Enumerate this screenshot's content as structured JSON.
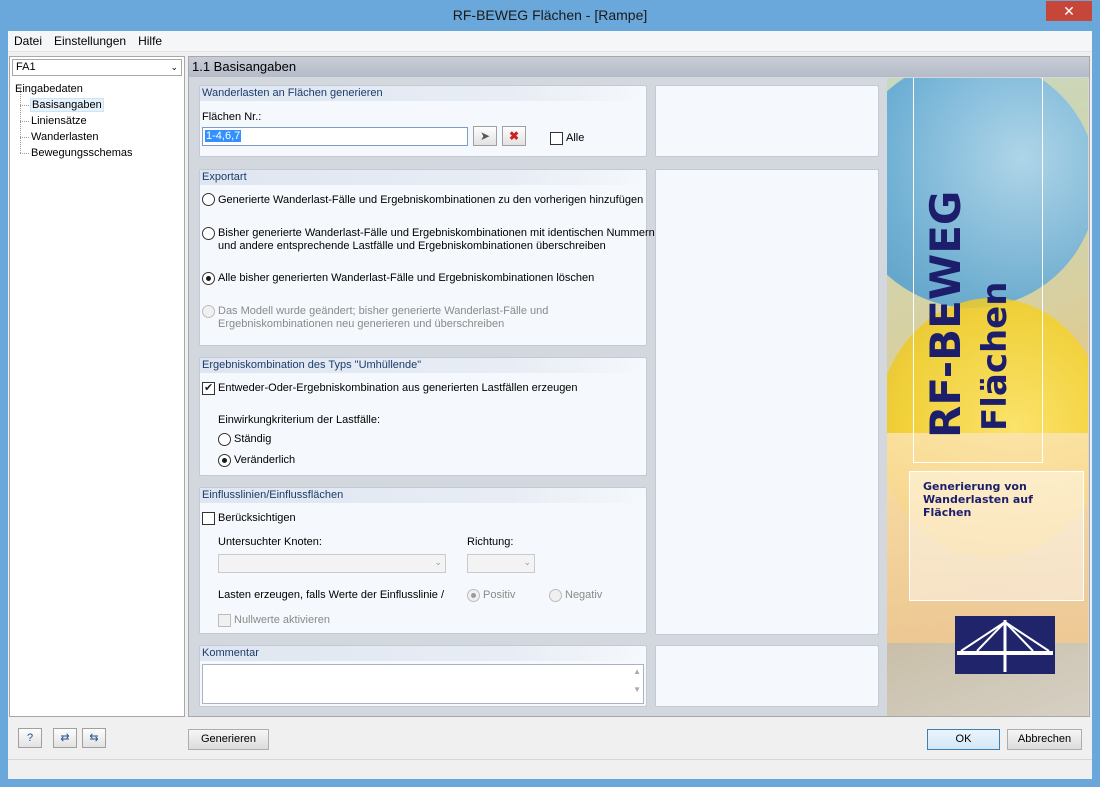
{
  "window": {
    "title": "RF-BEWEG Flächen - [Rampe]",
    "close_glyph": "✕"
  },
  "menu": [
    "Datei",
    "Einstellungen",
    "Hilfe"
  ],
  "nav": {
    "combo_value": "FA1",
    "root": "Eingabedaten",
    "items": [
      "Basisangaben",
      "Liniensätze",
      "Wanderlasten",
      "Bewegungsschemas"
    ],
    "selected_index": 0
  },
  "main": {
    "header": "1.1 Basisangaben",
    "gen": {
      "title": "Wanderlasten an Flächen generieren",
      "flaechen_label": "Flächen Nr.:",
      "flaechen_value": "1-4,6,7",
      "alle_label": "Alle",
      "alle_checked": false
    },
    "export": {
      "title": "Exportart",
      "options": [
        {
          "lines": [
            "Generierte Wanderlast-Fälle und Ergebniskombinationen zu den vorherigen hinzufügen"
          ],
          "checked": false,
          "enabled": true
        },
        {
          "lines": [
            "Bisher generierte Wanderlast-Fälle und Ergebniskombinationen mit identischen Nummern",
            "und andere entsprechende Lastfälle und Ergebniskombinationen überschreiben"
          ],
          "checked": false,
          "enabled": true
        },
        {
          "lines": [
            "Alle bisher generierten Wanderlast-Fälle und Ergebniskombinationen löschen"
          ],
          "checked": true,
          "enabled": true
        },
        {
          "lines": [
            "Das Modell wurde geändert; bisher generierte Wanderlast-Fälle und",
            "Ergebniskombinationen neu generieren und überschreiben"
          ],
          "checked": false,
          "enabled": false
        }
      ]
    },
    "envelope": {
      "title": "Ergebniskombination des Typs \"Umhüllende\"",
      "check_label": "Entweder-Oder-Ergebniskombination aus generierten Lastfällen erzeugen",
      "checked": true,
      "criterion_label": "Einwirkungkriterium der Lastfälle:",
      "option_standig": "Ständig",
      "option_veraenderlich": "Veränderlich",
      "selected": "Veränderlich"
    },
    "influence": {
      "title": "Einflusslinien/Einflussflächen",
      "check_label": "Berücksichtigen",
      "checked": false,
      "knoten_label": "Untersuchter Knoten:",
      "richtung_label": "Richtung:",
      "lasten_label": "Lasten erzeugen, falls Werte der Einflusslinie / E",
      "positiv_label": "Positiv",
      "negativ_label": "Negativ",
      "positiv_checked": true,
      "nullwerte_label": "Nullwerte aktivieren"
    },
    "comment": {
      "title": "Kommentar",
      "value": ""
    }
  },
  "banner": {
    "title1": "RF-BEWEG",
    "title2": "Flächen",
    "subtitle_line1": "Generierung von",
    "subtitle_line2": "Wanderlasten auf Flächen",
    "brand_color": "#1c1e6b"
  },
  "bottom": {
    "icons": [
      "help-icon",
      "import-icon",
      "export-icon"
    ],
    "generate_label": "Generieren",
    "ok_label": "OK",
    "cancel_label": "Abbrechen"
  }
}
